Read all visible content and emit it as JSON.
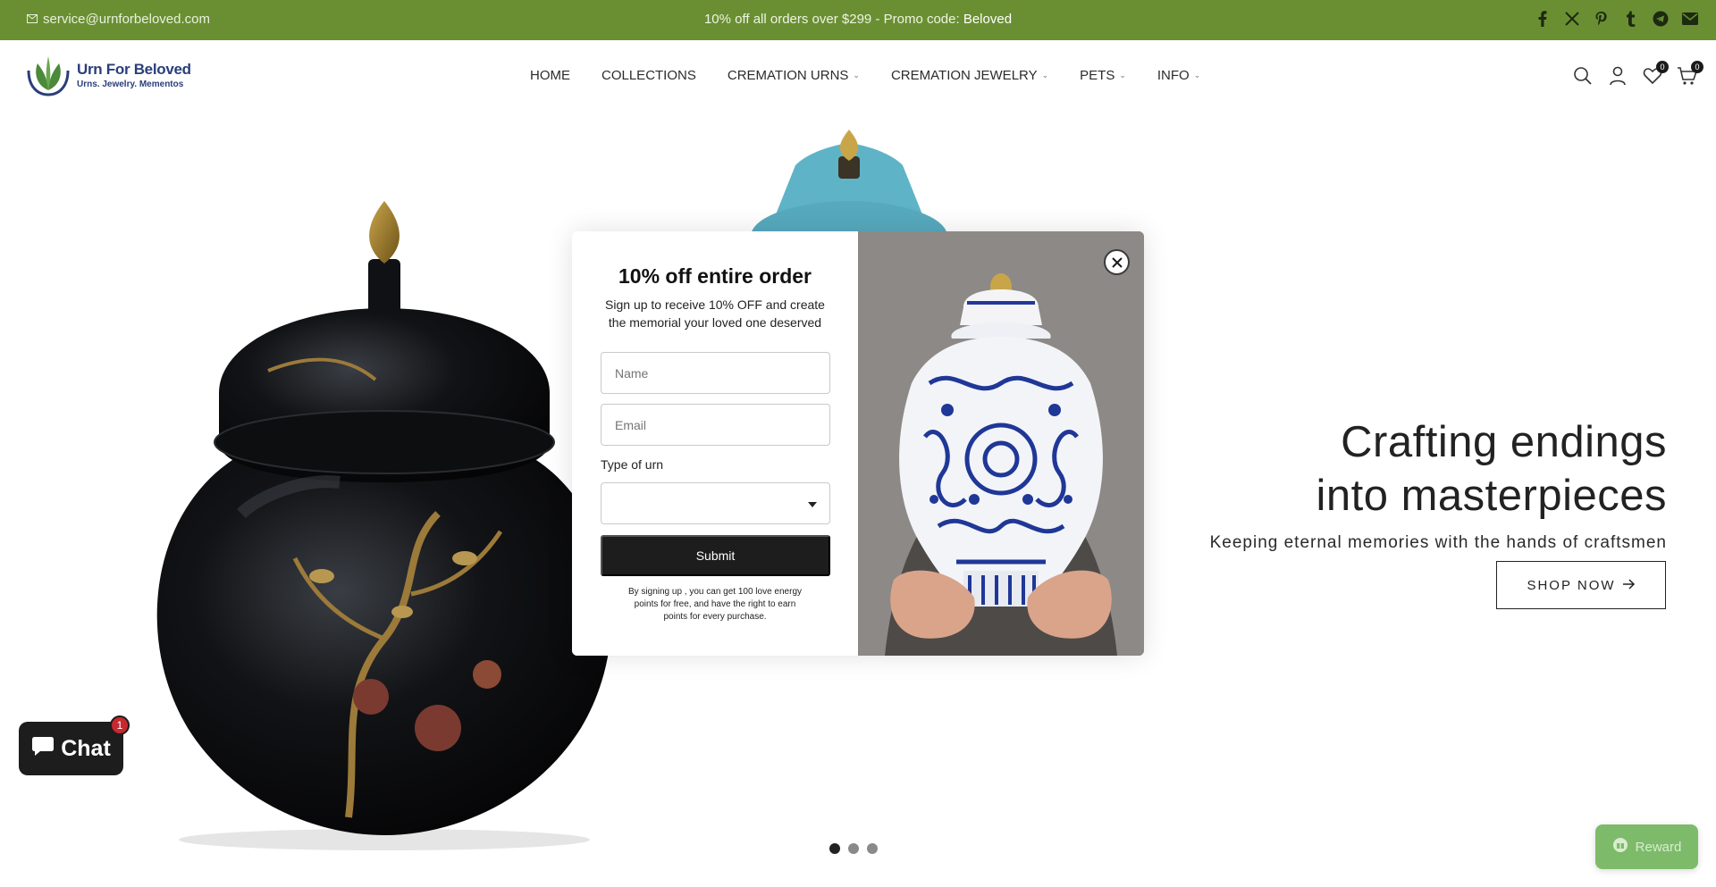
{
  "announcement": {
    "email": "service@urnforbeloved.com",
    "promo_text": "10% off all orders over $299 - Promo code: ",
    "promo_code": "Beloved",
    "social_icons": [
      "facebook-icon",
      "x-icon",
      "pinterest-icon",
      "tumblr-icon",
      "telegram-icon",
      "mail-icon"
    ]
  },
  "header": {
    "brand": "Urn For Beloved",
    "tagline": "Urns. Jewelry. Mementos",
    "nav": [
      {
        "label": "HOME",
        "dropdown": false
      },
      {
        "label": "COLLECTIONS",
        "dropdown": false
      },
      {
        "label": "CREMATION URNS",
        "dropdown": true
      },
      {
        "label": "CREMATION JEWELRY",
        "dropdown": true
      },
      {
        "label": "PETS",
        "dropdown": true
      },
      {
        "label": "INFO",
        "dropdown": true
      }
    ],
    "wishlist_count": "0",
    "cart_count": "0"
  },
  "hero": {
    "headline_line1": "Crafting endings",
    "headline_line2": "into masterpieces",
    "subtext": "Keeping eternal memories with the hands of craftsmen",
    "cta_label": "SHOP NOW",
    "slide_count": 3,
    "active_slide": 1
  },
  "modal": {
    "title": "10% off entire order",
    "subtitle": "Sign up to receive 10% OFF and create the memorial your loved one deserved",
    "name_placeholder": "Name",
    "email_placeholder": "Email",
    "select_label": "Type of urn",
    "select_value": "",
    "submit_label": "Submit",
    "fine_print": "By signing up , you can get 100 love energy points for free, and have the right to earn points for every purchase."
  },
  "chat": {
    "label": "Chat",
    "badge": "1"
  },
  "reward": {
    "label": "Reward"
  },
  "colors": {
    "announce_bg": "#6a8f33",
    "primary_dark": "#1d1d1d",
    "brand_blue": "#2a3e7a",
    "reward_green": "#7dbb6a"
  }
}
